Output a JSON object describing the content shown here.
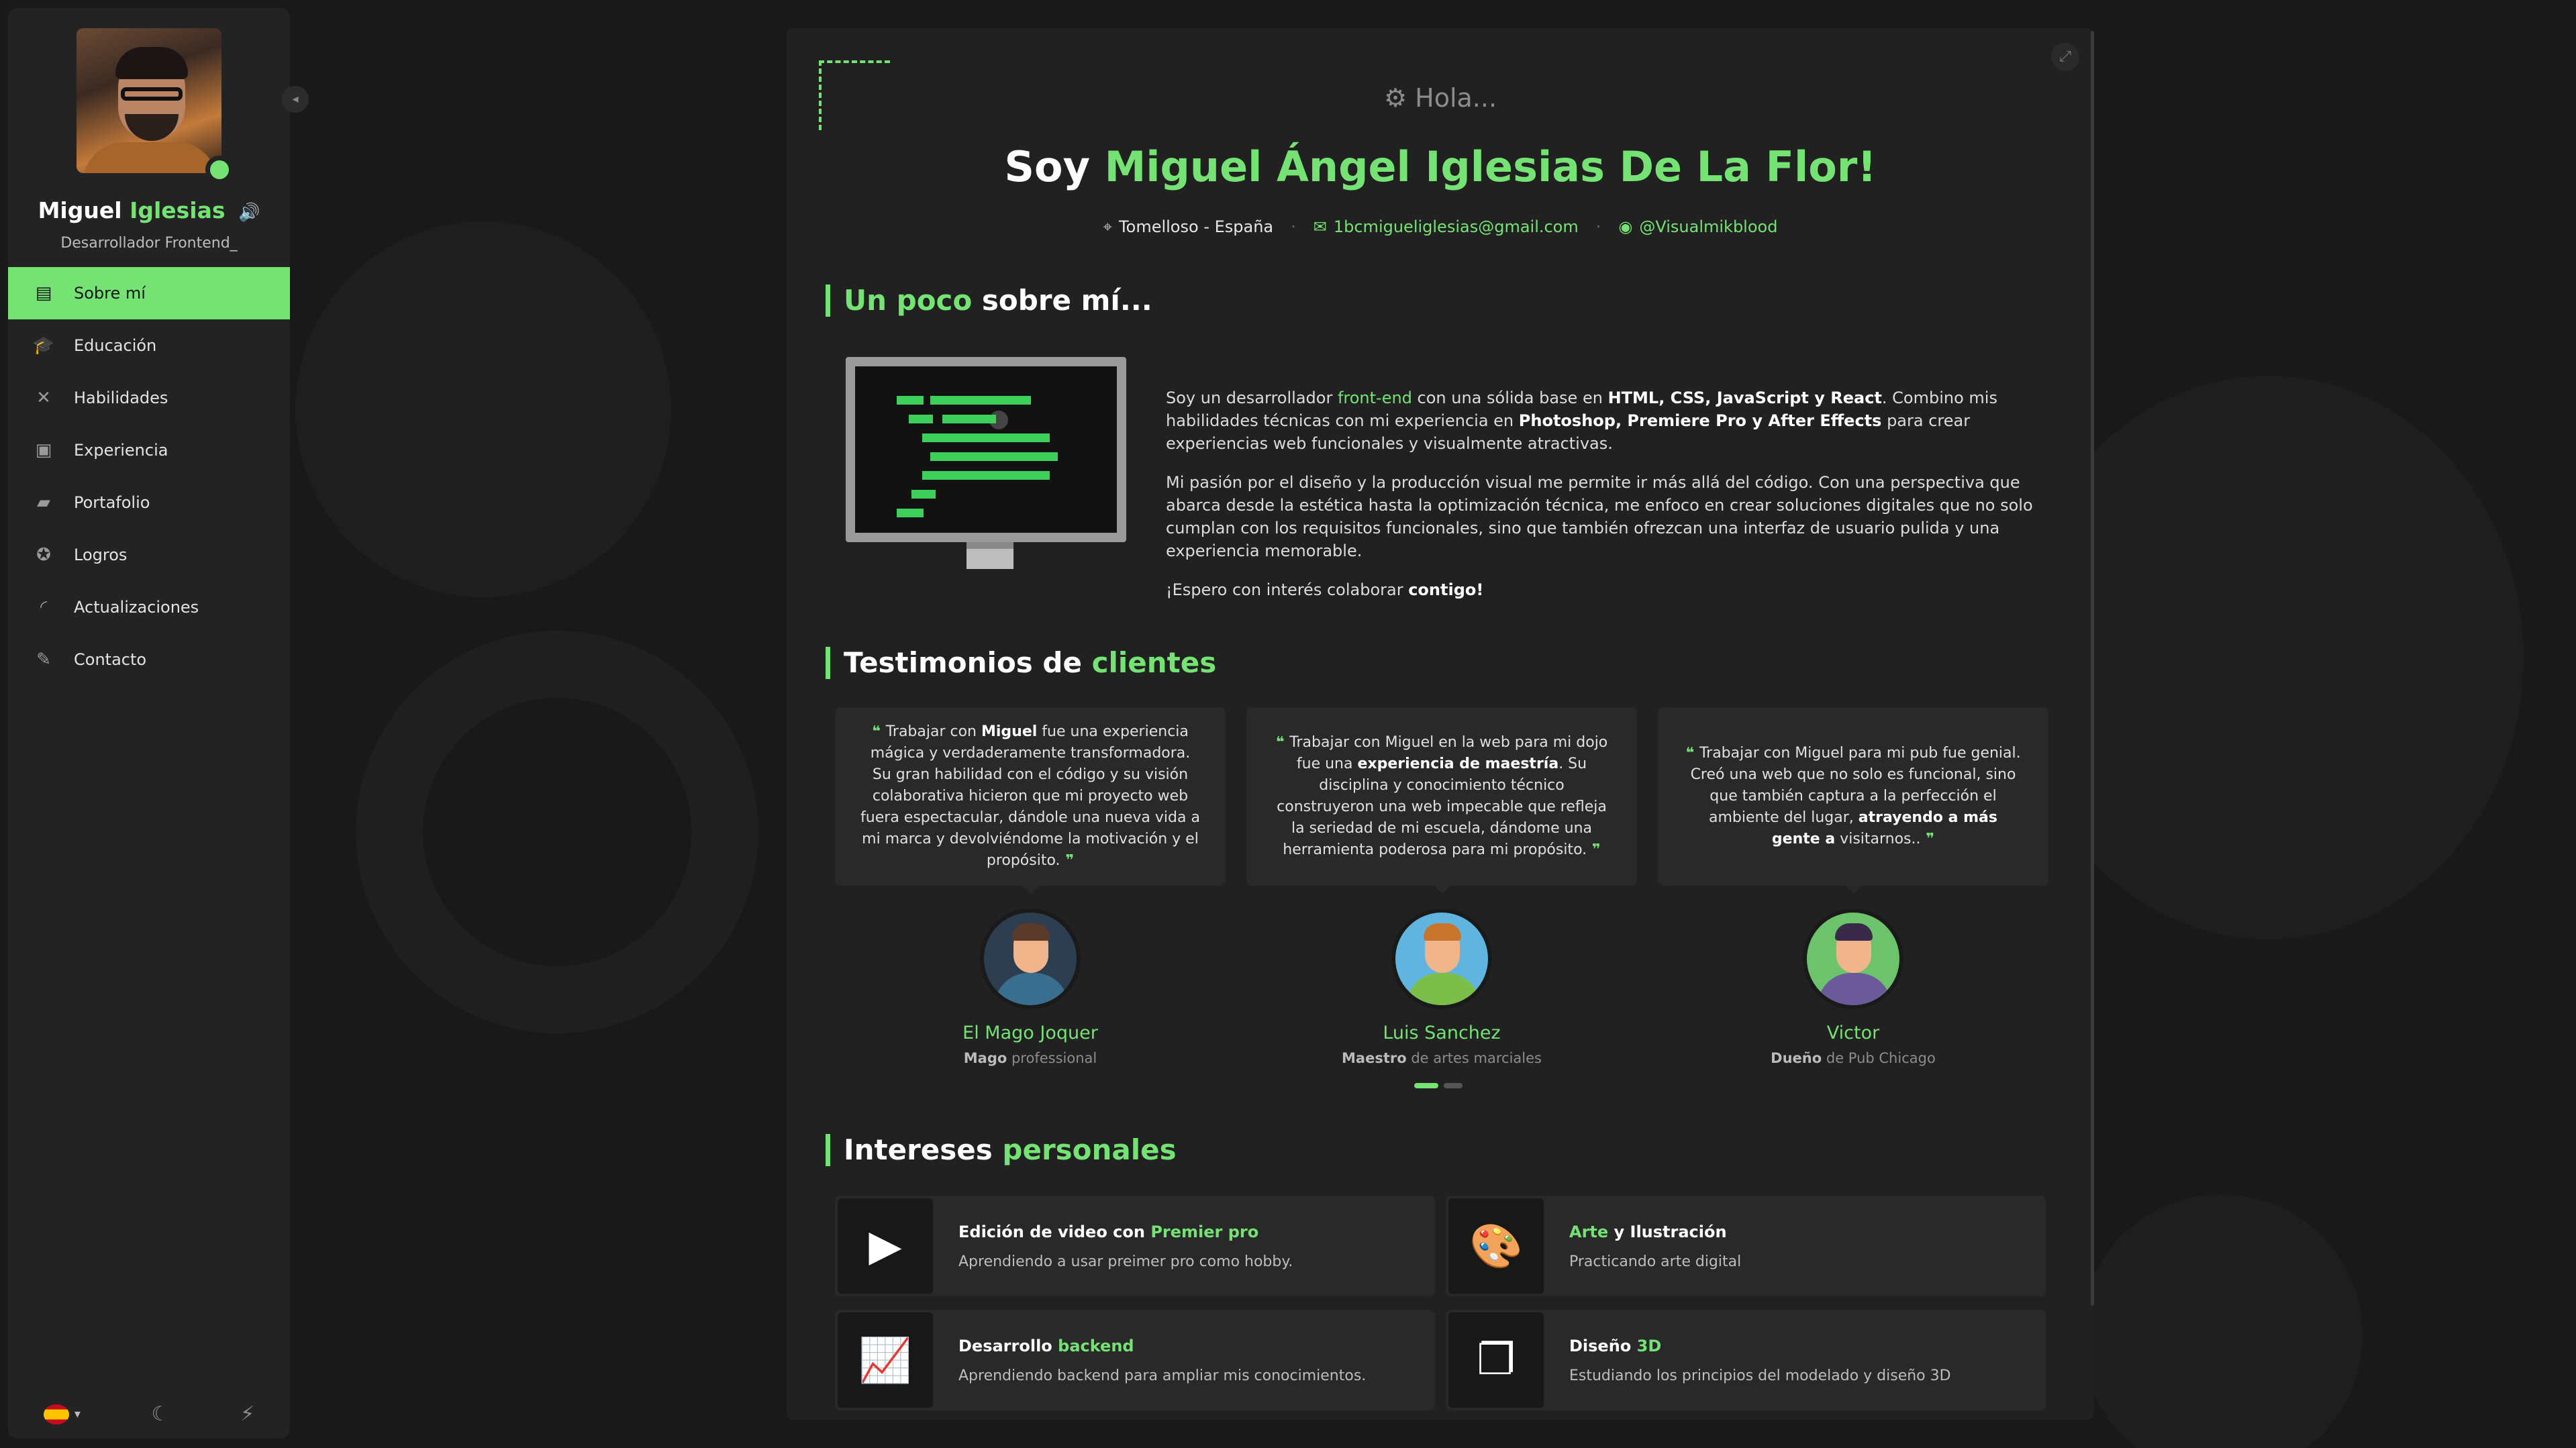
{
  "sidebar": {
    "first_name": "Miguel",
    "last_name": "Iglesias",
    "role": "Desarrollador Frontend_",
    "items": [
      {
        "label": "Sobre mí",
        "icon": "id-card-icon",
        "active": true
      },
      {
        "label": "Educación",
        "icon": "graduation-cap-icon"
      },
      {
        "label": "Habilidades",
        "icon": "tools-icon"
      },
      {
        "label": "Experiencia",
        "icon": "briefcase-icon"
      },
      {
        "label": "Portafolio",
        "icon": "folder-open-icon"
      },
      {
        "label": "Logros",
        "icon": "award-icon"
      },
      {
        "label": "Actualizaciones",
        "icon": "rss-icon"
      },
      {
        "label": "Contacto",
        "icon": "edit-icon"
      }
    ]
  },
  "hero": {
    "greeting": "Hola...",
    "title_prefix": "Soy",
    "title_name": "Miguel Ángel Iglesias De La Flor!",
    "location": "Tomelloso - España",
    "email": "1bcmigueliglesias@gmail.com",
    "github": "@Visualmikblood"
  },
  "about": {
    "title_a": "Un poco",
    "title_b": "sobre mí...",
    "p1": {
      "t1": "Soy un desarrollador ",
      "g1": "front-end",
      "t2": " con una sólida base en ",
      "b1": "HTML, CSS, JavaScript y React",
      "t3": ". Combino mis habilidades técnicas con mi experiencia en ",
      "b2": "Photoshop, Premiere Pro y After Effects",
      "t4": " para crear experiencias web funcionales y visualmente atractivas."
    },
    "p2": "Mi pasión por el diseño y la producción visual me permite ir más allá del código. Con una perspectiva que abarca desde la estética hasta la optimización técnica, me enfoco en crear soluciones digitales que no solo cumplan con los requisitos funcionales, sino que también ofrezcan una interfaz de usuario pulida y una experiencia memorable.",
    "p3_a": "¡Espero con interés colaborar ",
    "p3_b": "contigo!"
  },
  "testimonials": {
    "title_a": "Testimonios de",
    "title_b": "clientes",
    "items": [
      {
        "t1": "Trabajar con ",
        "b1": "Miguel",
        "t2": " fue una experiencia mágica y verdaderamente transformadora. Su gran habilidad con el código y su visión colaborativa hicieron que mi proyecto web fuera espectacular, dándole una nueva vida a mi marca y devolviéndome la motivación y el propósito.",
        "name": "El Mago Joquer",
        "role_b": "Mago",
        "role_t": " professional"
      },
      {
        "t1": "Trabajar con Miguel en la web para mi dojo fue una ",
        "b1": "experiencia de maestría",
        "t2": ". Su disciplina y conocimiento técnico construyeron una web impecable que refleja la seriedad de mi escuela, dándome una herramienta poderosa para mi propósito.",
        "name": "Luis Sanchez",
        "role_b": "Maestro",
        "role_t": " de artes marciales"
      },
      {
        "t1": "Trabajar con Miguel para mi pub fue genial. Creó una web que no solo es funcional, sino que también captura a la perfección el ambiente del lugar, ",
        "b1": "atrayendo a más gente a",
        "t2": " visitarnos..",
        "name": "Victor",
        "role_b": "Dueño",
        "role_t": " de Pub Chicago"
      }
    ]
  },
  "interests": {
    "title_a": "Intereses",
    "title_b": "personales",
    "items": [
      {
        "t": "Edición de video con ",
        "g": "Premier pro",
        "t2": "",
        "desc": "Aprendiendo a usar preimer pro como hobby.",
        "icon": "video-camera-icon"
      },
      {
        "t": "",
        "g": "Arte",
        "t2": " y Ilustración",
        "desc": "Practicando arte digital",
        "icon": "palette-icon"
      },
      {
        "t": "Desarrollo ",
        "g": "backend",
        "t2": "",
        "desc": "Aprendiendo backend para ampliar mis conocimientos.",
        "icon": "chart-line-icon"
      },
      {
        "t": "Diseño ",
        "g": "3D",
        "t2": "",
        "desc": "Estudiando los principios del modelado y diseño 3D",
        "icon": "cube-icon"
      }
    ]
  },
  "colors": {
    "accent": "#74e374",
    "background": "#191919",
    "panel": "#212121"
  }
}
